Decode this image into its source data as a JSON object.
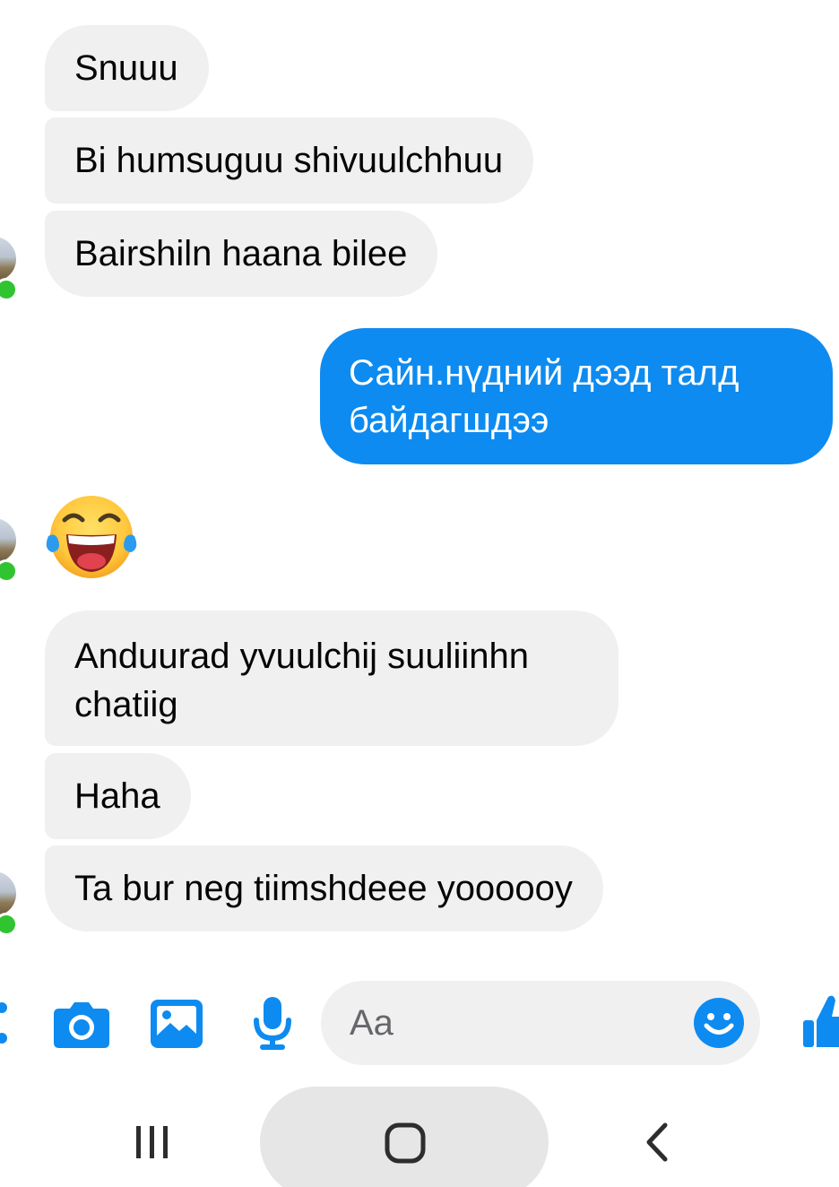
{
  "messages": [
    {
      "sender": "other",
      "text": "Snuuu"
    },
    {
      "sender": "other",
      "text": "Bi humsuguu shivuulchhuu"
    },
    {
      "sender": "other",
      "text": "Bairshiln haana bilee"
    },
    {
      "sender": "me",
      "text": "Сайн.нүдний дээд талд байдагшдээ"
    },
    {
      "sender": "other",
      "emoji": "face-with-tears-of-joy"
    },
    {
      "sender": "other",
      "text": "Anduurad yvuulchij suuliinhn chatiig"
    },
    {
      "sender": "other",
      "text": "Haha"
    },
    {
      "sender": "other",
      "text": "Ta bur neg tiimshdeee yoooooy"
    }
  ],
  "composer": {
    "placeholder": "Aa"
  },
  "colors": {
    "incoming_bubble": "#f0f0f0",
    "outgoing_bubble": "#0d8bf0",
    "accent": "#0d8bf0",
    "online_dot": "#31c431"
  },
  "icons": {
    "toolbar": [
      "more-icon",
      "camera-icon",
      "image-icon",
      "microphone-icon",
      "emoji-icon",
      "thumbs-up-icon"
    ],
    "navbar": [
      "recent-apps-icon",
      "home-icon",
      "back-icon"
    ]
  }
}
